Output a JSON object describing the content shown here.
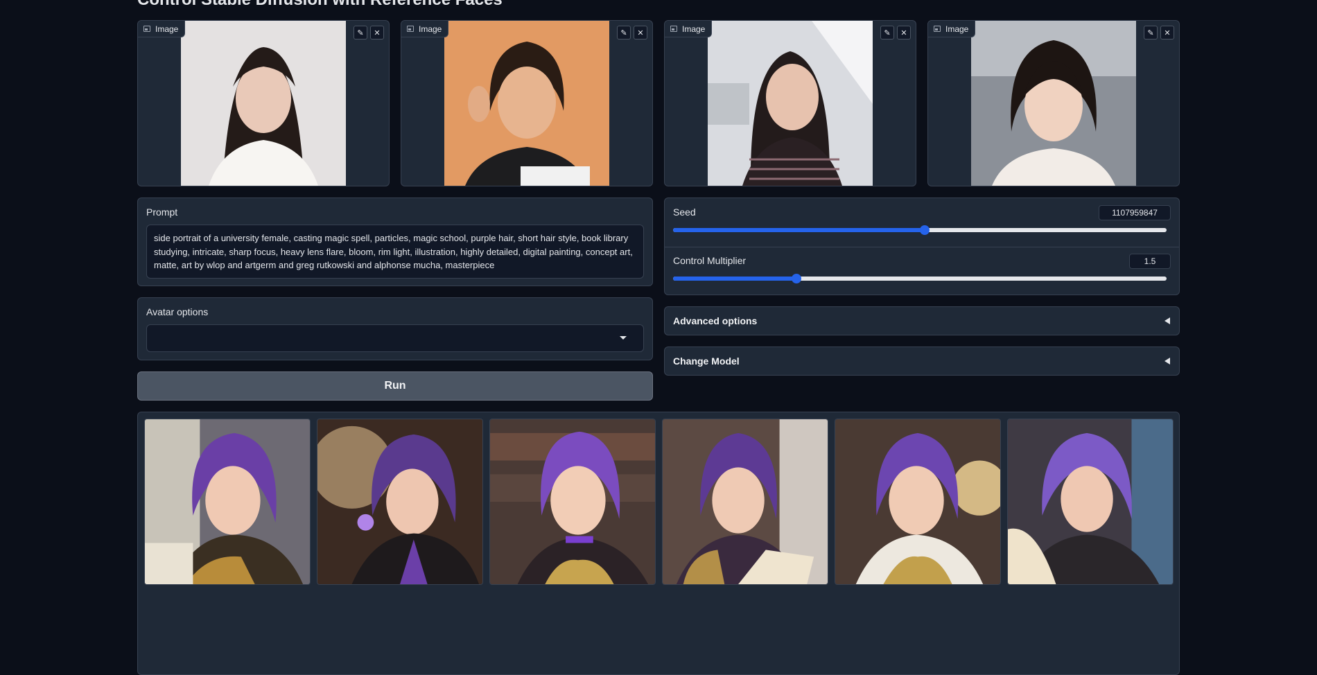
{
  "page": {
    "title": "Control Stable Diffusion with Reference Faces"
  },
  "reference_images": [
    {
      "label": "Image",
      "edit_icon": "pencil-icon",
      "close_icon": "close-icon"
    },
    {
      "label": "Image",
      "edit_icon": "pencil-icon",
      "close_icon": "close-icon"
    },
    {
      "label": "Image",
      "edit_icon": "pencil-icon",
      "close_icon": "close-icon"
    },
    {
      "label": "Image",
      "edit_icon": "pencil-icon",
      "close_icon": "close-icon"
    }
  ],
  "prompt": {
    "label": "Prompt",
    "value": "side portrait of a university female, casting magic spell, particles, magic school, purple hair, short hair style, book library studying, intricate, sharp focus, heavy lens flare, bloom, rim light, illustration, highly detailed, digital painting, concept art, matte, art by wlop and artgerm and greg rutkowski and alphonse mucha, masterpiece"
  },
  "avatar": {
    "label": "Avatar options",
    "value": ""
  },
  "run": {
    "label": "Run"
  },
  "seed": {
    "label": "Seed",
    "value": "1107959847",
    "fraction": 0.51
  },
  "multiplier": {
    "label": "Control Multiplier",
    "value": "1.5",
    "fraction": 0.25
  },
  "advanced": {
    "label": "Advanced options"
  },
  "change_model": {
    "label": "Change Model"
  },
  "gallery": {
    "count": 6
  },
  "colors": {
    "accent": "#2563eb",
    "background": "#0b0f19",
    "panel": "#1f2937",
    "border": "#374151"
  }
}
